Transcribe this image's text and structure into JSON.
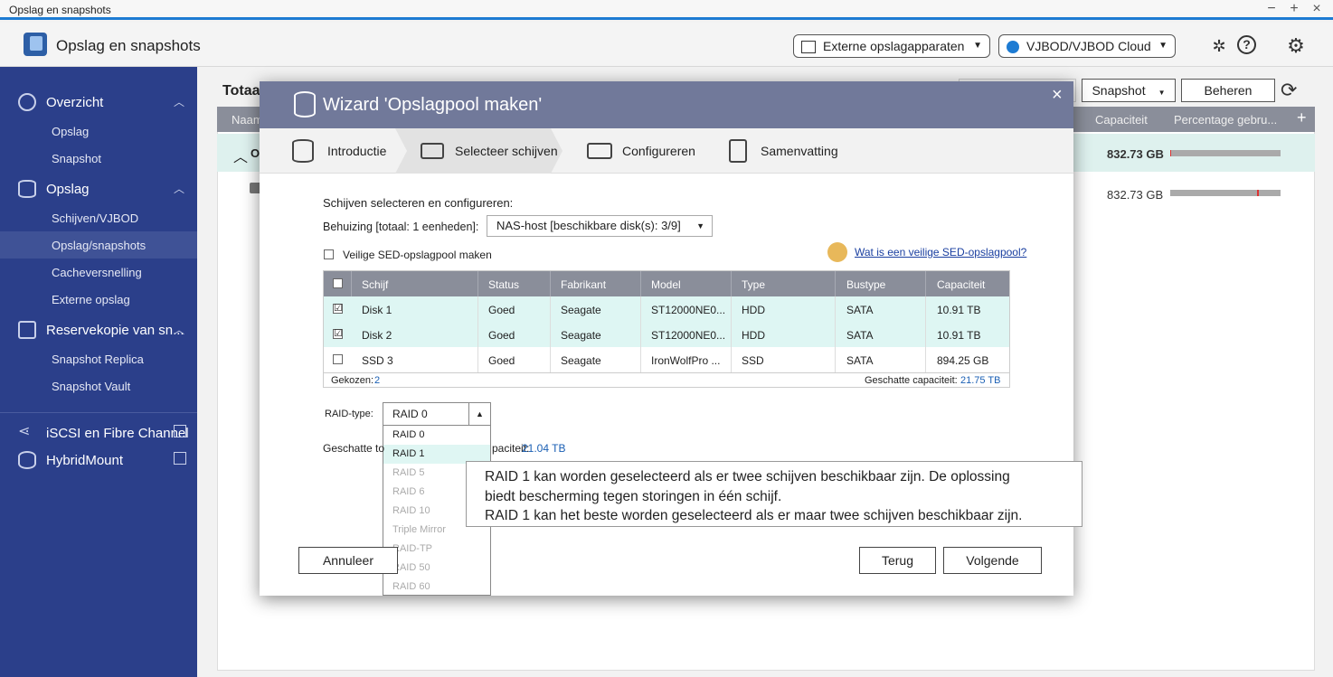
{
  "window": {
    "title": "Opslag en snapshots",
    "controls": [
      "−",
      "+",
      "×"
    ]
  },
  "header": {
    "app_title": "Opslag en snapshots",
    "external_devices": "Externe opslagapparaten",
    "vjbod": "VJBOD/VJBOD Cloud"
  },
  "sidebar": {
    "overview": {
      "label": "Overzicht",
      "items": [
        "Opslag",
        "Snapshot"
      ]
    },
    "storage": {
      "label": "Opslag",
      "items": [
        "Schijven/VJBOD",
        "Opslag/snapshots",
        "Cacheversnelling",
        "Externe opslag"
      ]
    },
    "backup": {
      "label": "Reservekopie van sn...",
      "items": [
        "Snapshot Replica",
        "Snapshot Vault"
      ]
    },
    "iscsi": "iSCSI en Fibre Channel",
    "hybridmount": "HybridMount"
  },
  "background": {
    "title": "Totaa",
    "snapshot_button": "Snapshot",
    "manage_button": "Beheren",
    "col_name": "Naam",
    "col_capacity": "Capaciteit",
    "col_percentage": "Percentage gebru...",
    "row1_label": "O",
    "row1_capacity": "832.73 GB",
    "row2_capacity": "832.73 GB",
    "row1_usage": 0.01,
    "row2_usage": 0.8
  },
  "wizard": {
    "title": "Wizard 'Opslagpool maken'",
    "steps": [
      "Introductie",
      "Selecteer schijven",
      "Configureren",
      "Samenvatting"
    ],
    "section_title": "Schijven selecteren en configureren:",
    "enclosure_label": "Behuizing [totaal: 1 eenheden]:",
    "enclosure_value": "NAS-host [beschikbare disk(s): 3/9]",
    "sed_label": "Veilige SED-opslagpool maken",
    "sed_help": "Wat is een veilige SED-opslagpool?",
    "table": {
      "headers": [
        "Schijf",
        "Status",
        "Fabrikant",
        "Model",
        "Type",
        "Bustype",
        "Capaciteit"
      ],
      "rows": [
        {
          "checked": "☑",
          "disk": "Disk 1",
          "status": "Goed",
          "maker": "Seagate",
          "model": "ST12000NE0...",
          "type": "HDD",
          "bus": "SATA",
          "cap": "10.91 TB"
        },
        {
          "checked": "☑",
          "disk": "Disk 2",
          "status": "Goed",
          "maker": "Seagate",
          "model": "ST12000NE0...",
          "type": "HDD",
          "bus": "SATA",
          "cap": "10.91 TB"
        },
        {
          "checked": "",
          "disk": "SSD 3",
          "status": "Goed",
          "maker": "Seagate",
          "model": "IronWolfPro ...",
          "type": "SSD",
          "bus": "SATA",
          "cap": "894.25 GB"
        }
      ],
      "chosen_label": "Gekozen:",
      "chosen_value": "2",
      "est_label": "Geschatte capaciteit:",
      "est_value": "21.75 TB"
    },
    "raid_label": "RAID-type:",
    "raid_value": "RAID 0",
    "raid_options": [
      "RAID 0",
      "RAID 1",
      "RAID 5",
      "RAID 6",
      "RAID 10",
      "Triple Mirror",
      "RAID-TP",
      "RAID 50",
      "RAID 60"
    ],
    "est2_prefix": "Geschatte to",
    "est2_suffix": "paciteit:",
    "est2_value": "21.04 TB",
    "tooltip": [
      "RAID 1 kan worden geselecteerd als er twee schijven beschikbaar zijn. De oplossing",
      "biedt bescherming tegen storingen in één schijf.",
      "RAID 1 kan het beste worden geselecteerd als er maar twee schijven beschikbaar zijn."
    ],
    "cancel": "Annuleer",
    "back": "Terug",
    "next": "Volgende"
  }
}
